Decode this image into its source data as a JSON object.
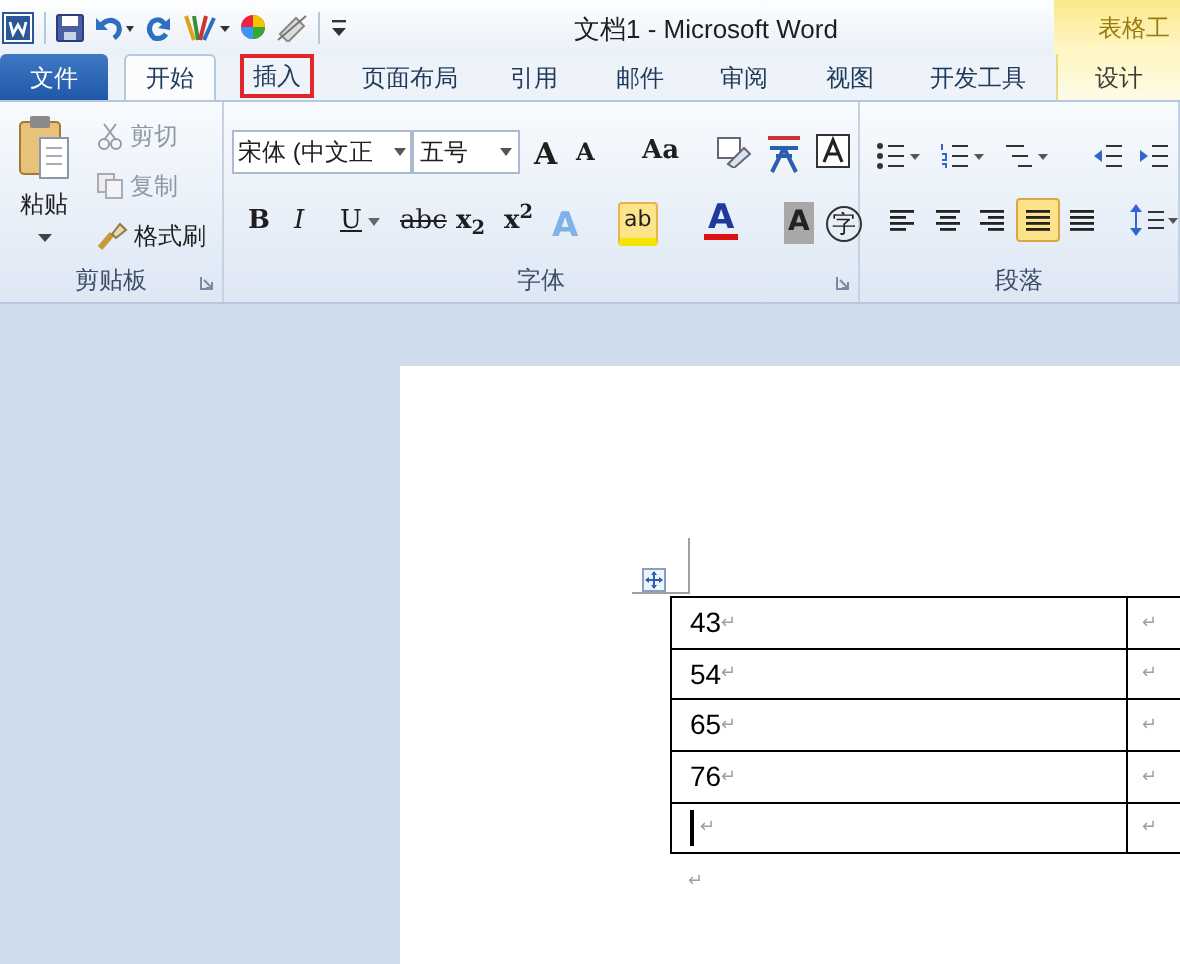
{
  "window": {
    "title": "文档1 - Microsoft Word",
    "context_tab": "表格工"
  },
  "tabs": [
    {
      "label": "文件",
      "kind": "file",
      "selected": false,
      "highlighted": false
    },
    {
      "label": "开始",
      "kind": "tab",
      "selected": true,
      "highlighted": false
    },
    {
      "label": "插入",
      "kind": "tab",
      "selected": false,
      "highlighted": true
    },
    {
      "label": "页面布局",
      "kind": "tab",
      "selected": false,
      "highlighted": false
    },
    {
      "label": "引用",
      "kind": "tab",
      "selected": false,
      "highlighted": false
    },
    {
      "label": "邮件",
      "kind": "tab",
      "selected": false,
      "highlighted": false
    },
    {
      "label": "审阅",
      "kind": "tab",
      "selected": false,
      "highlighted": false
    },
    {
      "label": "视图",
      "kind": "tab",
      "selected": false,
      "highlighted": false
    },
    {
      "label": "开发工具",
      "kind": "tab",
      "selected": false,
      "highlighted": false
    },
    {
      "label": "设计",
      "kind": "context",
      "selected": false,
      "highlighted": false
    }
  ],
  "clipboard": {
    "paste": "粘贴",
    "cut": "剪切",
    "copy": "复制",
    "format_painter": "格式刷",
    "label": "剪贴板"
  },
  "font": {
    "name": "宋体 (中文正",
    "size": "五号",
    "label": "字体",
    "row1": [
      "A",
      "A",
      "Aa"
    ],
    "row2": [
      "B",
      "I",
      "U",
      "abc",
      "x$_{2}$",
      "x$^{2}$"
    ],
    "row2b": [
      "A",
      "ab",
      "A",
      "A",
      "字"
    ]
  },
  "paragraph": {
    "label": "段落",
    "alignment": [
      {
        "selected": false
      },
      {
        "selected": false
      },
      {
        "selected": false
      },
      {
        "selected": true
      },
      {
        "selected": false
      }
    ]
  },
  "table": {
    "rows": [
      {
        "cells": [
          {
            "text": "43",
            "mark": "↵"
          },
          {
            "mark": "↵"
          }
        ],
        "cursor": false
      },
      {
        "cells": [
          {
            "text": "54",
            "mark": "↵"
          },
          {
            "mark": "↵"
          }
        ],
        "cursor": false
      },
      {
        "cells": [
          {
            "text": "65",
            "mark": "↵"
          },
          {
            "mark": "↵"
          }
        ],
        "cursor": false
      },
      {
        "cells": [
          {
            "text": "76",
            "mark": "↵"
          },
          {
            "mark": "↵"
          }
        ],
        "cursor": false
      },
      {
        "cells": [
          {
            "mark": "↵"
          },
          {
            "mark": "↵"
          }
        ],
        "cursor": true
      }
    ]
  },
  "after_table_mark": "↵"
}
